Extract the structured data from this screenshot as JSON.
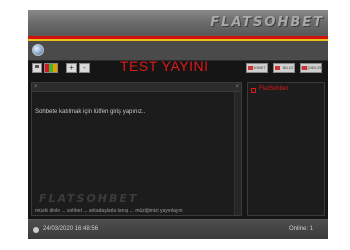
{
  "header": {
    "brand": "FLATSOHBET"
  },
  "toolbar": {
    "save_icon": "save-icon",
    "colors_icon": "color-palette-icon",
    "zoom_in_glyph": "+",
    "zoom_out_glyph": "-"
  },
  "title": "TEST YAYINI",
  "user_tabs": [
    "SOHBET",
    "BİLGİ",
    "SEÇMELER"
  ],
  "chat": {
    "message": "Sohbete katılmak için lütfen giriş yapınız..",
    "watermark": "FLATSOHBET",
    "marquee": "müzik dinle ... sohbet ... arkadaşlarla tanış ... müziğimizi yayınlayın"
  },
  "users": [
    {
      "name": "FlatSohbet"
    }
  ],
  "status": {
    "datetime": "24/03/2020 16:48:56",
    "online": "Online: 1"
  },
  "colors": {
    "accent_red": "#d40f0f",
    "accent_yellow": "#e8c21a",
    "title_red": "#e01818"
  }
}
